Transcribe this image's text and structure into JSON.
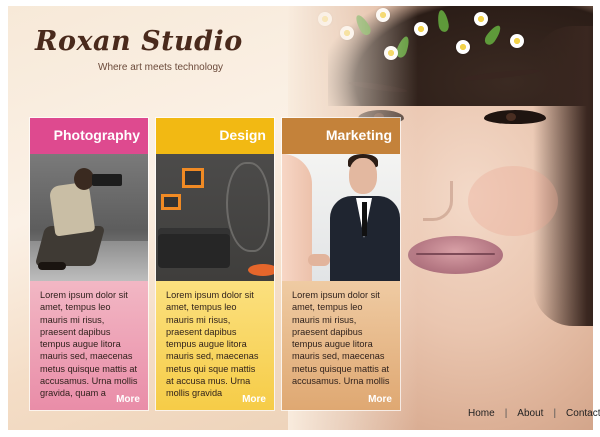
{
  "brand": {
    "name": "Roxan Studio",
    "tagline": "Where art meets technology"
  },
  "cards": [
    {
      "title": "Photography",
      "text": "Lorem ipsum dolor sit amet, tempus leo mauris mi risus, praesent dapibus tempus augue litora mauris sed, maecenas metus quisque mattis at accusamus. Urna mollis gravida, quam a",
      "more": "More",
      "color": "#de4a8f"
    },
    {
      "title": "Design",
      "text": "Lorem ipsum dolor sit amet, tempus leo mauris mi risus, praesent dapibus tempus augue litora mauris sed, maecenas metus qui sque mattis at accusa mus. Urna mollis gravida",
      "more": "More",
      "color": "#f2b913"
    },
    {
      "title": "Marketing",
      "text": "Lorem ipsum dolor sit amet, tempus leo mauris mi risus, praesent dapibus tempus augue litora mauris sed, maecenas metus quisque mattis at accusamus. Urna mollis",
      "more": "More",
      "color": "#c4823a"
    }
  ],
  "footer_nav": {
    "home": "Home",
    "about": "About",
    "contact": "Contact",
    "separator": "|"
  }
}
